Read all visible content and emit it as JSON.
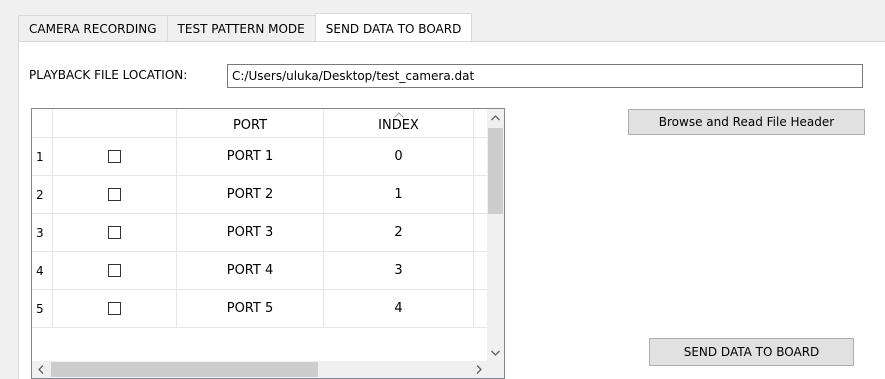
{
  "tabs": [
    {
      "label": "CAMERA RECORDING",
      "active": false
    },
    {
      "label": "TEST PATTERN MODE",
      "active": false
    },
    {
      "label": "SEND DATA TO BOARD",
      "active": true
    }
  ],
  "playback": {
    "label": "PLAYBACK FILE LOCATION:",
    "value": "C:/Users/uluka/Desktop/test_camera.dat"
  },
  "buttons": {
    "browse_label": "Browse and Read File Header",
    "send_label": "SEND DATA TO BOARD"
  },
  "table": {
    "columns": [
      "",
      "PORT",
      "INDEX"
    ],
    "rows": [
      {
        "num": "1",
        "checked": false,
        "port": "PORT 1",
        "index": "0"
      },
      {
        "num": "2",
        "checked": false,
        "port": "PORT 2",
        "index": "1"
      },
      {
        "num": "3",
        "checked": false,
        "port": "PORT 3",
        "index": "2"
      },
      {
        "num": "4",
        "checked": false,
        "port": "PORT 4",
        "index": "3"
      },
      {
        "num": "5",
        "checked": false,
        "port": "PORT 5",
        "index": "4"
      }
    ]
  },
  "icons": {
    "sort": "chevron-up-icon",
    "scroll_up": "arrow-up-icon",
    "scroll_down": "arrow-down-icon",
    "scroll_left": "arrow-left-icon",
    "scroll_right": "arrow-right-icon"
  },
  "colors": {
    "window_bg": "#f0f0f0",
    "panel_bg": "#ffffff",
    "button_bg": "#e1e1e1",
    "scroll_thumb": "#cdcdcd"
  }
}
